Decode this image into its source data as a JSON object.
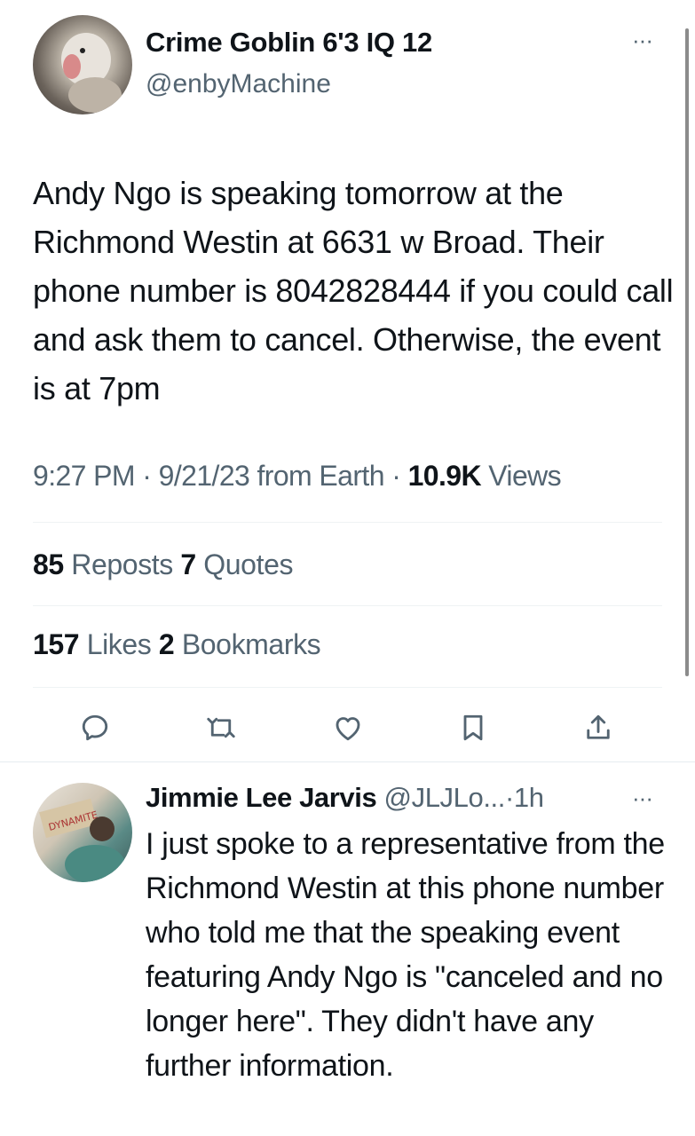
{
  "tweet": {
    "display_name": "Crime Goblin 6'3 IQ 12",
    "handle": "@enbyMachine",
    "more_label": "···",
    "text": "Andy Ngo is speaking tomorrow at the Richmond Westin at 6631 w Broad. Their phone number is 8042828444 if you could call and ask them to cancel. Otherwise, the event is at 7pm",
    "time": "9:27 PM",
    "date": "9/21/23",
    "source": "from Earth",
    "views_count": "10.9K",
    "views_label": "Views",
    "separator": "·"
  },
  "stats": {
    "reposts_count": "85",
    "reposts_label": "Reposts",
    "quotes_count": "7",
    "quotes_label": "Quotes",
    "likes_count": "157",
    "likes_label": "Likes",
    "bookmarks_count": "2",
    "bookmarks_label": "Bookmarks"
  },
  "actions": {
    "reply_icon": "reply-icon",
    "repost_icon": "repost-icon",
    "like_icon": "heart-icon",
    "bookmark_icon": "bookmark-icon",
    "share_icon": "share-icon"
  },
  "reply": {
    "display_name": "Jimmie Lee Jarvis",
    "handle": "@JLJLo...",
    "separator": "·",
    "time": "1h",
    "more_label": "···",
    "text": "I just spoke to a representative from the Richmond Westin at this phone number who told me that the speaking event featuring Andy Ngo is \"canceled and no longer here\". They didn't have any further information."
  },
  "colors": {
    "text_primary": "#0f1419",
    "text_secondary": "#536471",
    "divider": "#eff3f4"
  }
}
